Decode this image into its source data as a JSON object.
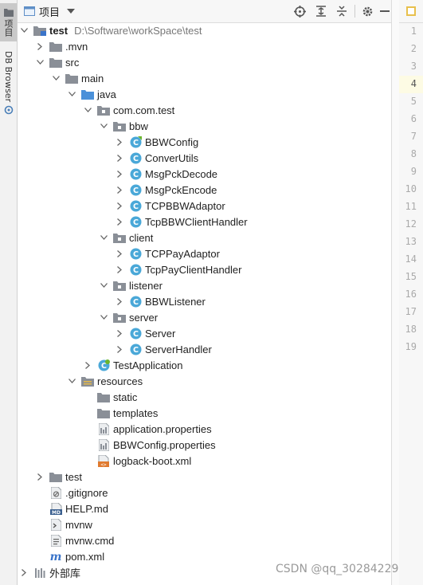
{
  "left_strip": {
    "project_tab": "项目",
    "db_browser_tab": "DB Browser"
  },
  "header": {
    "title": "项目",
    "icons": [
      "crosshair-icon",
      "expand-all-icon",
      "collapse-all-icon",
      "gear-icon",
      "minimize-icon"
    ]
  },
  "tree": {
    "root_name": "test",
    "root_path": "D:\\Software\\workSpace\\test",
    "items": [
      {
        "label": ".mvn",
        "icon": "folder-icon"
      },
      {
        "label": "src",
        "icon": "folder-icon"
      },
      {
        "label": "main",
        "icon": "folder-icon"
      },
      {
        "label": "java",
        "icon": "source-folder-icon"
      },
      {
        "label": "com.com.test",
        "icon": "package-icon"
      },
      {
        "label": "bbw",
        "icon": "package-icon"
      },
      {
        "label": "BBWConfig",
        "icon": "spring-config-class-icon"
      },
      {
        "label": "ConverUtils",
        "icon": "class-icon"
      },
      {
        "label": "MsgPckDecode",
        "icon": "class-icon"
      },
      {
        "label": "MsgPckEncode",
        "icon": "class-icon"
      },
      {
        "label": "TCPBBWAdaptor",
        "icon": "class-icon"
      },
      {
        "label": "TcpBBWClientHandler",
        "icon": "class-icon"
      },
      {
        "label": "client",
        "icon": "package-icon"
      },
      {
        "label": "TCPPayAdaptor",
        "icon": "class-icon"
      },
      {
        "label": "TcpPayClientHandler",
        "icon": "class-icon"
      },
      {
        "label": "listener",
        "icon": "package-icon"
      },
      {
        "label": "BBWListener",
        "icon": "class-icon"
      },
      {
        "label": "server",
        "icon": "package-icon"
      },
      {
        "label": "Server",
        "icon": "class-icon"
      },
      {
        "label": "ServerHandler",
        "icon": "class-icon"
      },
      {
        "label": "TestApplication",
        "icon": "spring-boot-app-icon"
      },
      {
        "label": "resources",
        "icon": "resources-folder-icon"
      },
      {
        "label": "static",
        "icon": "folder-icon"
      },
      {
        "label": "templates",
        "icon": "folder-icon"
      },
      {
        "label": "application.properties",
        "icon": "properties-file-icon"
      },
      {
        "label": "BBWConfig.properties",
        "icon": "properties-file-icon"
      },
      {
        "label": "logback-boot.xml",
        "icon": "xml-file-icon"
      },
      {
        "label": "test",
        "icon": "folder-icon"
      },
      {
        "label": ".gitignore",
        "icon": "gitignore-file-icon"
      },
      {
        "label": "HELP.md",
        "icon": "markdown-file-icon"
      },
      {
        "label": "mvnw",
        "icon": "shell-file-icon"
      },
      {
        "label": "mvnw.cmd",
        "icon": "cmd-file-icon"
      },
      {
        "label": "pom.xml",
        "icon": "maven-pom-icon"
      },
      {
        "label": "外部库",
        "icon": "external-libraries-icon"
      }
    ]
  },
  "gutter": {
    "line_numbers": [
      "1",
      "2",
      "3",
      "4",
      "5",
      "6",
      "7",
      "8",
      "9",
      "10",
      "11",
      "12",
      "13",
      "14",
      "15",
      "16",
      "17",
      "18",
      "19"
    ],
    "current_line": "4"
  },
  "watermark": "CSDN @qq_30284229",
  "colors": {
    "folder": "#8a8f97",
    "class_circle": "#4aa8d8",
    "spring_green": "#6cb52d",
    "xml_orange": "#e07a2f",
    "maven_blue": "#3a74c9"
  }
}
